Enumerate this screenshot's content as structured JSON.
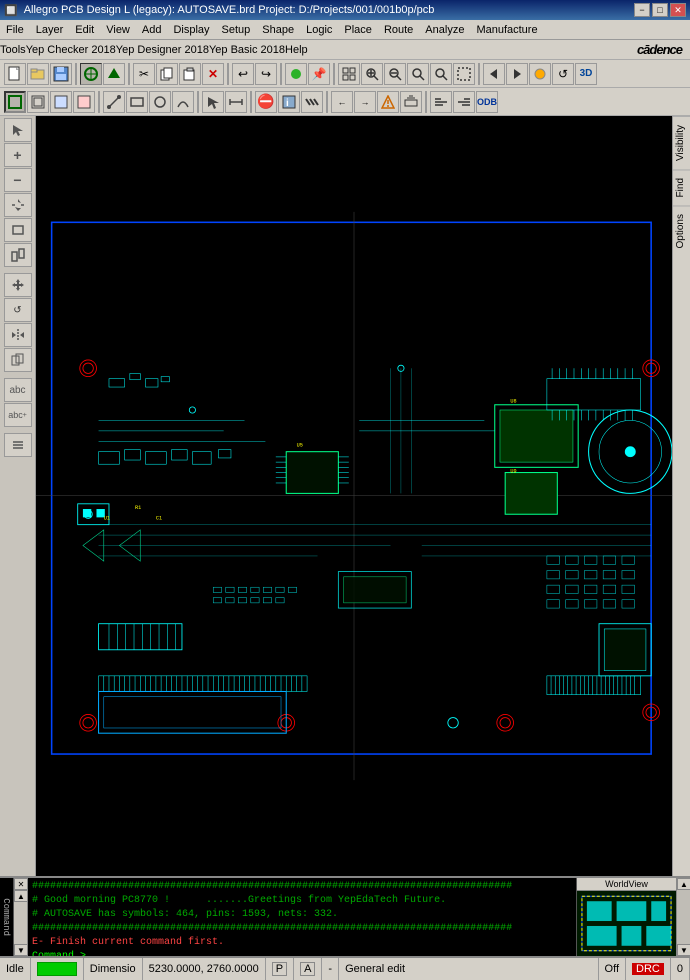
{
  "titlebar": {
    "title": "Allegro PCB Design L (legacy): AUTOSAVE.brd  Project: D:/Projects/001/001b0p/pcb",
    "min_btn": "−",
    "max_btn": "□",
    "close_btn": "✕"
  },
  "menubar": {
    "items": [
      "File",
      "Layer",
      "Edit",
      "View",
      "Add",
      "Display",
      "Setup",
      "Shape",
      "Logic",
      "Place",
      "Route",
      "Analyze",
      "Manufacture"
    ]
  },
  "yepmenubar": {
    "items": [
      "Tools",
      "Yep Checker 2018",
      "Yep Designer 2018",
      "Yep Basic 2018",
      "Help"
    ],
    "logo": "cādence"
  },
  "console": {
    "lines": [
      "################################################################################",
      "# Good morning PC8770 !      .......Greetings from YepEdaTech Future.",
      "# AUTOSAVE has symbols: 464, pins: 1593, nets: 332.",
      "################################################################################",
      "E- Finish current command first.",
      "Command >"
    ],
    "label": "Command"
  },
  "statusbar": {
    "idle": "Idle",
    "indicator": "",
    "dimensio": "Dimensio",
    "coords": "5230.0000, 2760.0000",
    "p_flag": "P",
    "a_flag": "A",
    "dash": "-",
    "mode": "General edit",
    "off": "Off",
    "drc": "DRC",
    "num": "0"
  },
  "right_panel": {
    "tabs": [
      "Visibility",
      "Find",
      "Options"
    ]
  },
  "minimap": {
    "label": "WorldView"
  },
  "toolbar1": {
    "buttons": [
      "📁",
      "💾",
      "✂",
      "📋",
      "↩",
      "↪",
      "🔧",
      "📌",
      "⊞",
      "⊟",
      "🔍",
      "🔍",
      "🔍",
      "🔎",
      "🔄",
      "3D"
    ]
  }
}
